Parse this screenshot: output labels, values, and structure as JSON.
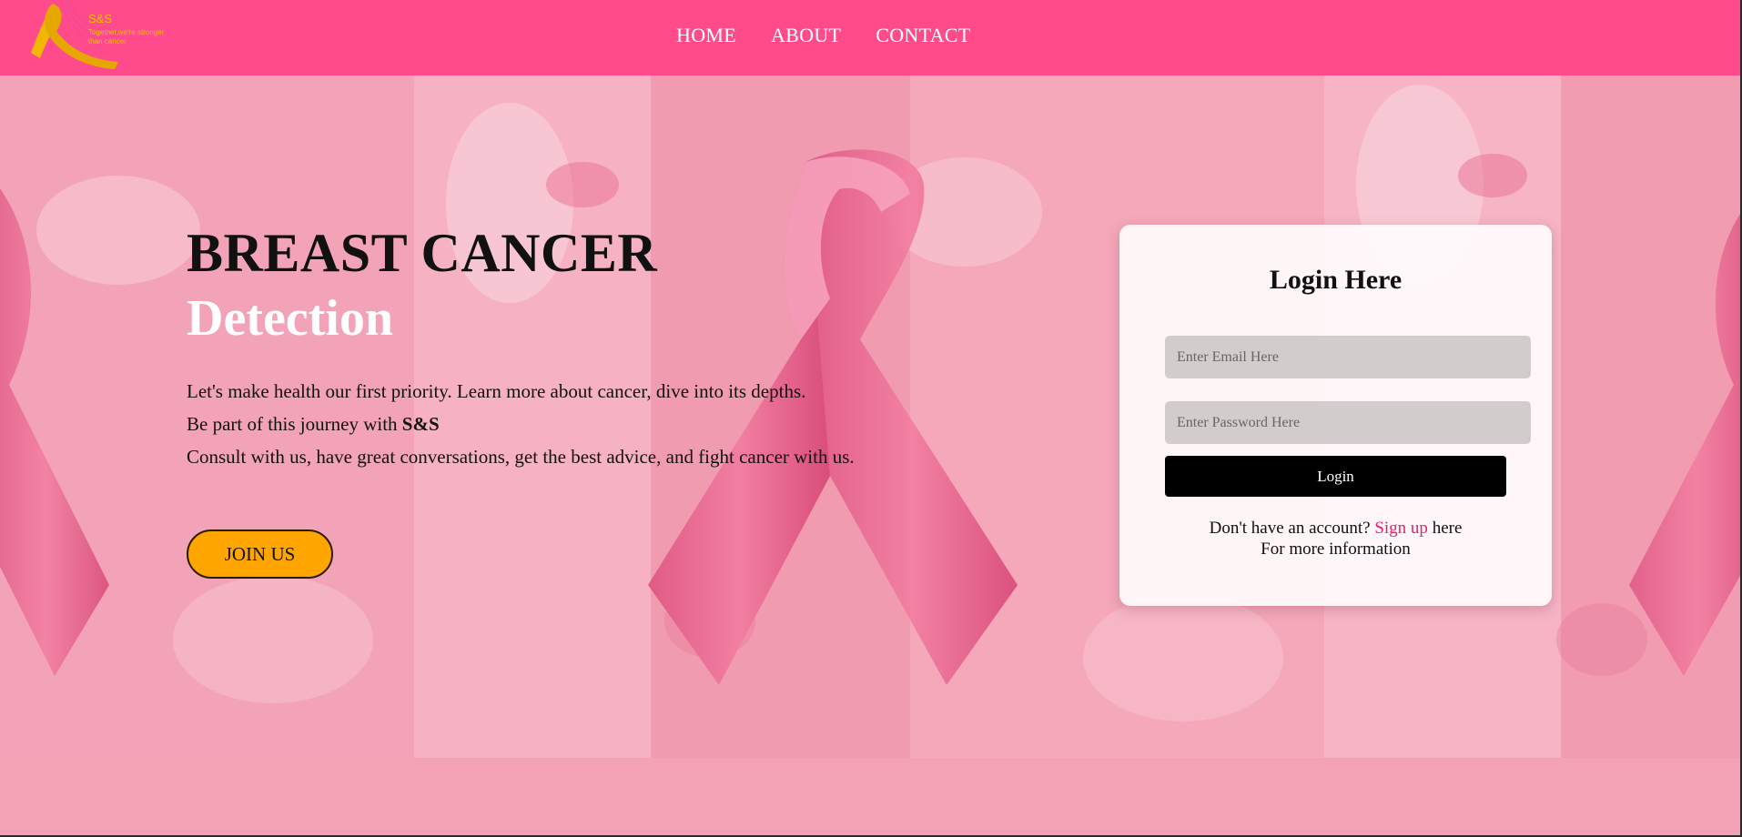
{
  "brand": {
    "name": "S&S",
    "tagline": "Together,we're stronger than cancer",
    "primary_color": "#ff4b8b",
    "accent_color": "#ffa500",
    "link_color": "#e61e71",
    "logo_icon": "pink-ribbon-logo-icon"
  },
  "nav": {
    "items": [
      {
        "label": "HOME"
      },
      {
        "label": "ABOUT"
      },
      {
        "label": "CONTACT"
      }
    ]
  },
  "hero": {
    "title": "BREAST CANCER",
    "subtitle": "Detection",
    "line1": "Let's make health our first priority. Learn more about cancer, dive into its depths.",
    "line2_prefix": "Be part of this journey with ",
    "line2_brand": "S&S",
    "line3": "Consult with us, have great conversations, get the best advice, and fight cancer with us.",
    "cta_label": "JOIN US"
  },
  "login": {
    "title": "Login Here",
    "email_placeholder": "Enter Email Here",
    "password_placeholder": "Enter Password Here",
    "button_label": "Login",
    "signup_prefix": "Don't have an account? ",
    "signup_link": "Sign up",
    "signup_suffix": " here",
    "info": "For more information"
  }
}
